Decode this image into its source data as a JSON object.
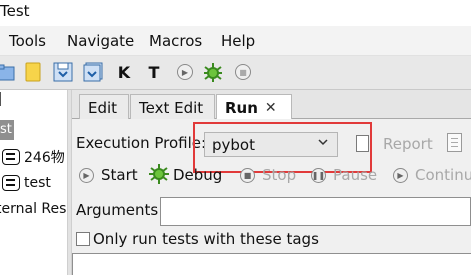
{
  "window": {
    "title": "Test"
  },
  "menu": {
    "items": [
      "Tools",
      "Navigate",
      "Macros",
      "Help"
    ]
  },
  "toolbar": {
    "k_label": "K",
    "t_label": "T",
    "icons": [
      "open-folder-icon",
      "new-file-icon",
      "save-icon",
      "save-all-icon",
      "keyword-search-icon",
      "test-search-icon",
      "run-icon",
      "debug-bug-icon",
      "stop-icon"
    ]
  },
  "tree": {
    "selected_label": "st",
    "items": [
      {
        "label": "246物",
        "icon": "test-suite-icon"
      },
      {
        "label": "test",
        "icon": "test-suite-icon"
      },
      {
        "label": "ternal Res"
      }
    ]
  },
  "tabs": [
    {
      "label": "Edit",
      "active": false
    },
    {
      "label": "Text Edit",
      "active": false
    },
    {
      "label": "Run",
      "active": true,
      "close": "✕"
    }
  ],
  "run": {
    "profile_label": "Execution Profile:",
    "profile_value": "pybot",
    "report_label": "Report",
    "start_label": "Start",
    "debug_label": "Debug",
    "stop_label": "Stop",
    "pause_label": "Pause",
    "continue_label": "Continu",
    "arguments_label": "Arguments:",
    "arguments_value": "",
    "only_tags_label": "Only run tests with these tags"
  },
  "colors": {
    "highlight": "#e13a3a",
    "debug_icon": "#3a8a1e",
    "selected_tree": "#8f8f8f"
  }
}
